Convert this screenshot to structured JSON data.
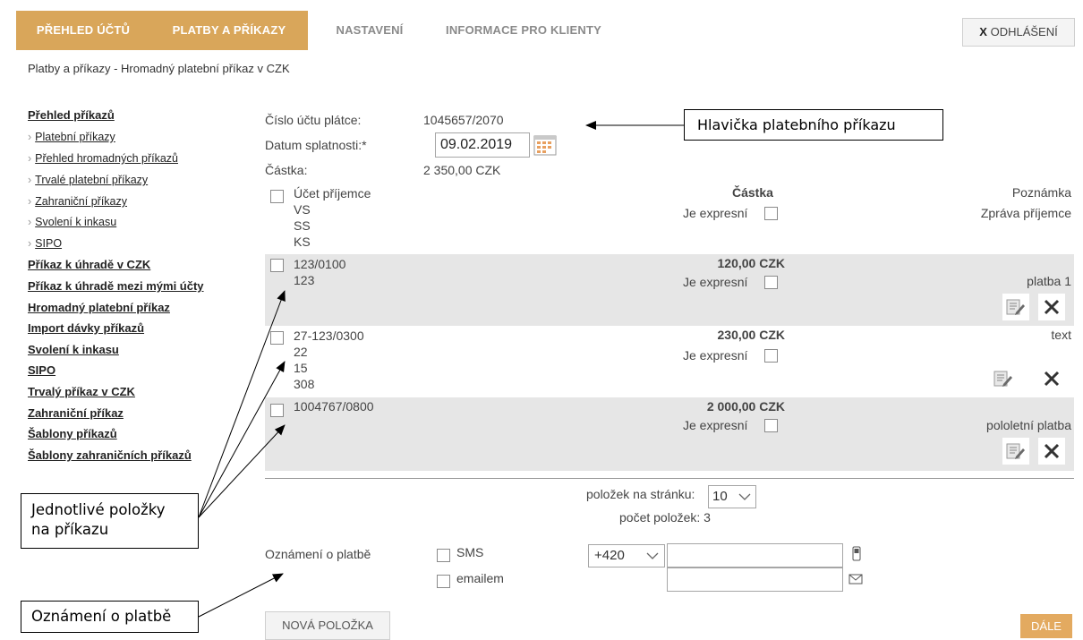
{
  "nav": {
    "tabs": [
      "PŘEHLED ÚČTŮ",
      "PLATBY A PŘÍKAZY",
      "NASTAVENÍ",
      "INFORMACE PRO KLIENTY"
    ],
    "logout_x": "X",
    "logout_label": "ODHLÁŠENÍ"
  },
  "breadcrumb": "Platby a příkazy - Hromadný platební příkaz v CZK",
  "sidebar": {
    "items": [
      "Přehled příkazů",
      "Platební příkazy",
      "Přehled hromadných příkazů",
      "Trvalé platební příkazy",
      "Zahraniční příkazy",
      "Svolení k inkasu",
      "SIPO",
      "Příkaz k úhradě v CZK",
      "Příkaz k úhradě mezi mými účty",
      "Hromadný platební příkaz",
      "Import dávky příkazů",
      "Svolení k inkasu",
      "SIPO",
      "Trvalý příkaz v CZK",
      "Zahraniční příkaz",
      "Šablony příkazů",
      "Šablony zahraničních příkazů"
    ]
  },
  "header_form": {
    "account_label": "Číslo účtu plátce:",
    "account_value": "1045657/2070",
    "due_label": "Datum splatnosti:*",
    "due_value": "09.02.2019",
    "amount_label": "Částka:",
    "amount_value": "2 350,00 CZK"
  },
  "table": {
    "col_recipient": "Účet příjemce",
    "col_vs": "VS",
    "col_ss": "SS",
    "col_ks": "KS",
    "col_amount": "Částka",
    "col_express": "Je expresní",
    "col_note": "Poznámka",
    "col_message": "Zpráva příjemce",
    "rows": [
      {
        "account": "123/0100",
        "vs": "123",
        "ss": "",
        "ks": "",
        "amount": "120,00 CZK",
        "express": "Je expresní",
        "note": "platba 1"
      },
      {
        "account": "27-123/0300",
        "vs": "22",
        "ss": "15",
        "ks": "308",
        "amount": "230,00 CZK",
        "express": "Je expresní",
        "note": "text"
      },
      {
        "account": "1004767/0800",
        "vs": "",
        "ss": "",
        "ks": "",
        "amount": "2 000,00 CZK",
        "express": "Je expresní",
        "note": "pololetní platba"
      }
    ]
  },
  "pagination": {
    "per_page_label": "položek na stránku:",
    "per_page_value": "10",
    "count_label": "počet položek: 3"
  },
  "notification": {
    "label": "Oznámení o platbě",
    "sms_label": "SMS",
    "email_label": "emailem",
    "phone_prefix": "+420"
  },
  "buttons": {
    "new_item": "NOVÁ POLOŽKA",
    "next": "DÁLE"
  },
  "callouts": {
    "header": "Hlavička platebního příkazu",
    "items_line1": "Jednotlivé položky",
    "items_line2": "na příkazu",
    "notification": "Oznámení o platbě"
  },
  "colors": {
    "accent": "#d9a65a",
    "next_button": "#e3aa60",
    "row_band": "#e6e6e6"
  }
}
